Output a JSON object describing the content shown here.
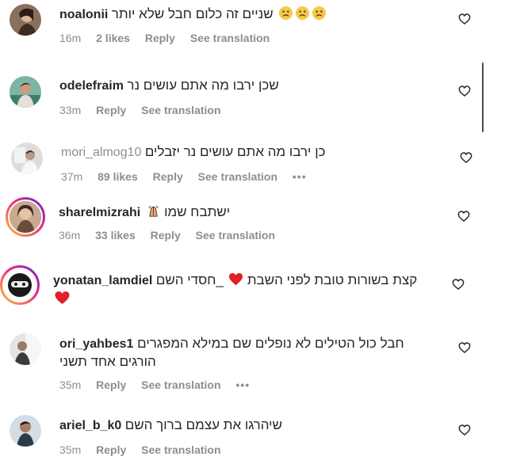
{
  "comments": [
    {
      "username": "noalonii",
      "text": "שניים זה כלום חבל שלא יותר",
      "emoji": [
        "sad-face",
        "sad-face",
        "sad-face"
      ],
      "time": "16m",
      "likes": "2 likes",
      "reply": "Reply",
      "translation": "See translation"
    },
    {
      "username": "odelefraim",
      "text": "שכן ירבו מה אתם עושים נר",
      "time": "33m",
      "reply": "Reply",
      "translation": "See translation"
    },
    {
      "username": "mori_almog10",
      "text": "כן ירבו מה אתם עושים נר יזבלים",
      "time": "37m",
      "likes": "89 likes",
      "reply": "Reply",
      "translation": "See translation",
      "more": "•••"
    },
    {
      "username": "sharelmizrahi",
      "text": "ישתבח שמו",
      "emoji": [
        "praying-hands"
      ],
      "time": "36m",
      "likes": "33 likes",
      "reply": "Reply",
      "translation": "See translation"
    },
    {
      "username": "yonatan_lamdiel",
      "text_part1": "_חסדי השם",
      "text_part2": "קצת בשורות טובת לפני השבת",
      "emoji": [
        "red-heart",
        "red-heart"
      ]
    },
    {
      "username": "ori_yahbes1",
      "text": "חבל כול הטילים לא נופלים שם במילא המפגרים הורגים אחד תשני",
      "time": "35m",
      "reply": "Reply",
      "translation": "See translation",
      "more": "•••"
    },
    {
      "username": "ariel_b_k0",
      "text": "שיהרגו את עצמם ברוך השם",
      "time": "35m",
      "reply": "Reply",
      "translation": "See translation"
    }
  ],
  "colors": {
    "text": "#262626",
    "secondary": "#8e8e8e",
    "heart_red": "#ed4956"
  },
  "icons": {
    "like": "heart-outline-icon",
    "more": "more-dots-icon"
  }
}
